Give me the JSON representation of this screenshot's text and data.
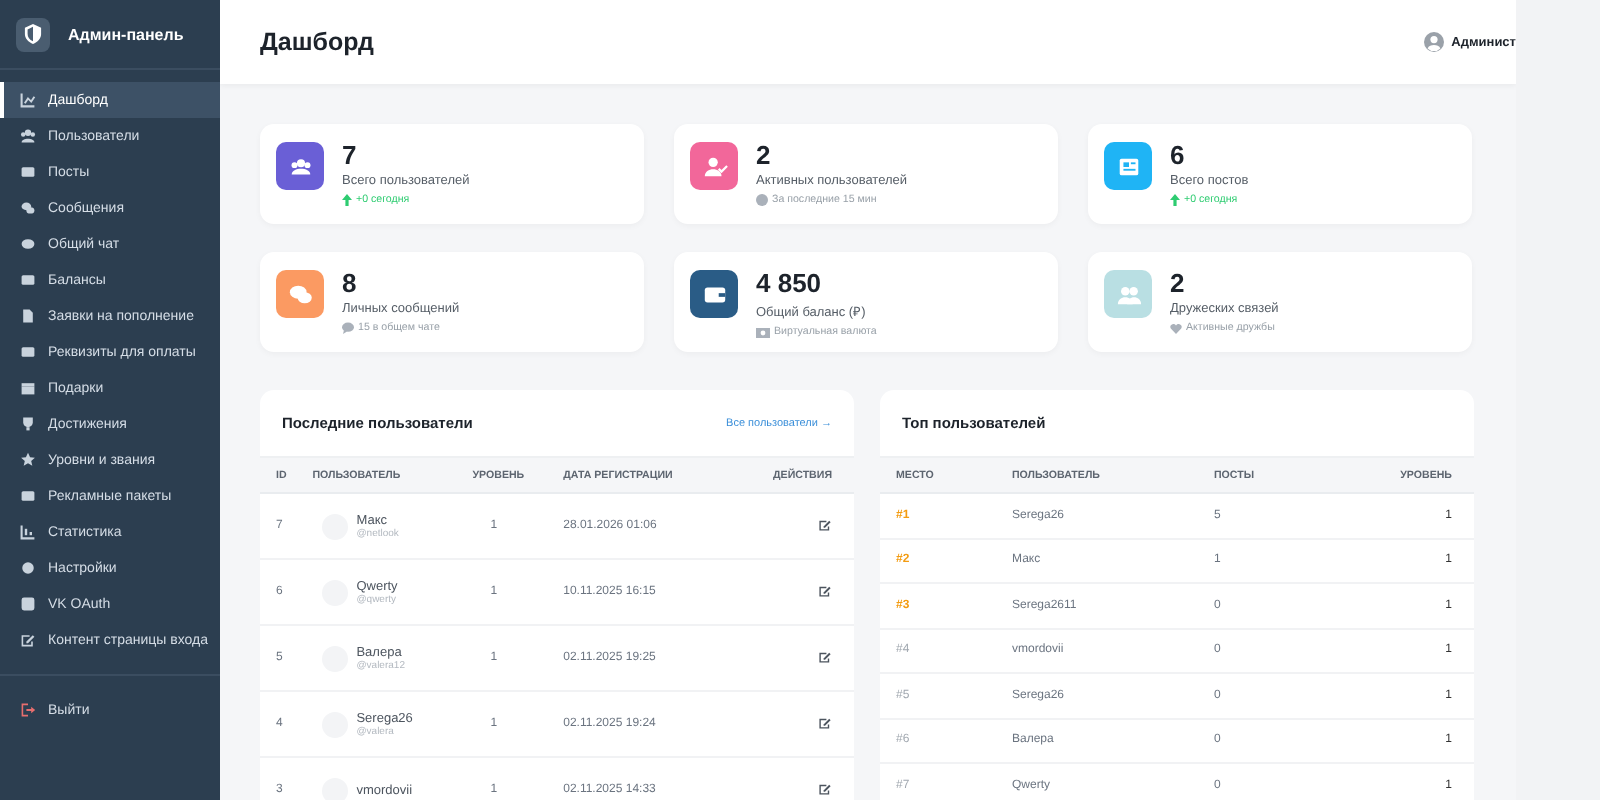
{
  "sidebar": {
    "brand": "Админ-панель",
    "items": [
      {
        "label": "Дашборд",
        "selected": true
      },
      {
        "label": "Пользователи",
        "selected": false
      },
      {
        "label": "Посты",
        "selected": false
      },
      {
        "label": "Сообщения",
        "selected": false
      },
      {
        "label": "Общий чат",
        "selected": false
      },
      {
        "label": "Балансы",
        "selected": false
      },
      {
        "label": "Заявки на пополнение",
        "selected": false
      },
      {
        "label": "Реквизиты для оплаты",
        "selected": false
      },
      {
        "label": "Подарки",
        "selected": false
      },
      {
        "label": "Достижения",
        "selected": false
      },
      {
        "label": "Уровни и звания",
        "selected": false
      },
      {
        "label": "Рекламные пакеты",
        "selected": false
      },
      {
        "label": "Статистика",
        "selected": false
      },
      {
        "label": "Настройки",
        "selected": false
      },
      {
        "label": "VK OAuth",
        "selected": false
      },
      {
        "label": "Контент страницы входа",
        "selected": false
      }
    ],
    "logout": "Выйти"
  },
  "header": {
    "title": "Дашборд",
    "user": "Админист"
  },
  "stats": [
    {
      "value": "7",
      "label": "Всего пользователей",
      "note": "+0 сегодня",
      "kind": "up",
      "color": "#6a5fd6"
    },
    {
      "value": "2",
      "label": "Активных пользователей",
      "note": "За последние 15 мин",
      "kind": "dot",
      "color": "#f2679a"
    },
    {
      "value": "6",
      "label": "Всего постов",
      "note": "+0 сегодня",
      "kind": "up",
      "color": "#1fb4f5"
    },
    {
      "value": "8",
      "label": "Личных сообщений",
      "note": "15 в общем чате",
      "kind": "chat",
      "color": "#fb9a62"
    },
    {
      "value": "4 850",
      "label": "Общий баланс (₽)",
      "note": "Виртуальная валюта",
      "kind": "money",
      "color": "#2a5c86"
    },
    {
      "value": "2",
      "label": "Дружеских связей",
      "note": "Активные дружбы",
      "kind": "heart",
      "color": "#b9dfe3"
    }
  ],
  "recent_users": {
    "title": "Последние пользователи",
    "link": "Все пользователи →",
    "columns": [
      "ID",
      "ПОЛЬЗОВАТЕЛЬ",
      "УРОВЕНЬ",
      "ДАТА РЕГИСТРАЦИИ",
      "ДЕЙСТВИЯ"
    ],
    "rows": [
      {
        "id": "7",
        "name": "Макс",
        "username": "@netlook",
        "level": "1",
        "date": "28.01.2026 01:06"
      },
      {
        "id": "6",
        "name": "Qwerty",
        "username": "@qwerty",
        "level": "1",
        "date": "10.11.2025 16:15"
      },
      {
        "id": "5",
        "name": "Валера",
        "username": "@valera12",
        "level": "1",
        "date": "02.11.2025 19:25"
      },
      {
        "id": "4",
        "name": "Serega26",
        "username": "@valera",
        "level": "1",
        "date": "02.11.2025 19:24"
      },
      {
        "id": "3",
        "name": "vmordovii",
        "level": "1",
        "date": "02.11.2025 14:33"
      }
    ]
  },
  "top_users": {
    "title": "Топ пользователей",
    "columns": [
      "МЕСТО",
      "ПОЛЬЗОВАТЕЛЬ",
      "ПОСТЫ",
      "УРОВЕНЬ"
    ],
    "rows": [
      {
        "place": "#1",
        "name": "Serega26",
        "posts": "5",
        "level": "1",
        "highlight": true
      },
      {
        "place": "#2",
        "name": "Макс",
        "posts": "1",
        "level": "1",
        "highlight": true
      },
      {
        "place": "#3",
        "name": "Serega2611",
        "posts": "0",
        "level": "1",
        "highlight": true
      },
      {
        "place": "#4",
        "name": "vmordovii",
        "posts": "0",
        "level": "1",
        "highlight": false
      },
      {
        "place": "#5",
        "name": "Serega26",
        "posts": "0",
        "level": "1",
        "highlight": false
      },
      {
        "place": "#6",
        "name": "Валера",
        "posts": "0",
        "level": "1",
        "highlight": false
      },
      {
        "place": "#7",
        "name": "Qwerty",
        "posts": "0",
        "level": "1",
        "highlight": false
      }
    ]
  }
}
